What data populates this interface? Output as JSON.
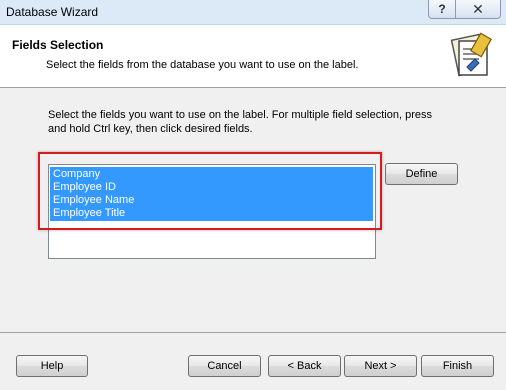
{
  "window": {
    "title": "Database Wizard",
    "help_glyph": "?",
    "close_glyph": "✕"
  },
  "header": {
    "title": "Fields Selection",
    "subtitle": "Select the fields from the database you want to use on the label.",
    "icon": "wizard-icon"
  },
  "body": {
    "instructions": "Select the fields you want to use on the label. For multiple field selection, press and hold Ctrl key, then click desired fields.",
    "fields": [
      "Company",
      "Employee ID",
      "Employee Name",
      "Employee Title"
    ],
    "define_label": "Define"
  },
  "footer": {
    "help_label": "Help",
    "cancel_label": "Cancel",
    "back_label": "< Back",
    "next_label": "Next >",
    "finish_label": "Finish"
  },
  "colors": {
    "selection": "#3399ff",
    "highlight": "#d11d1d",
    "titlebar": "#dce9f7"
  }
}
